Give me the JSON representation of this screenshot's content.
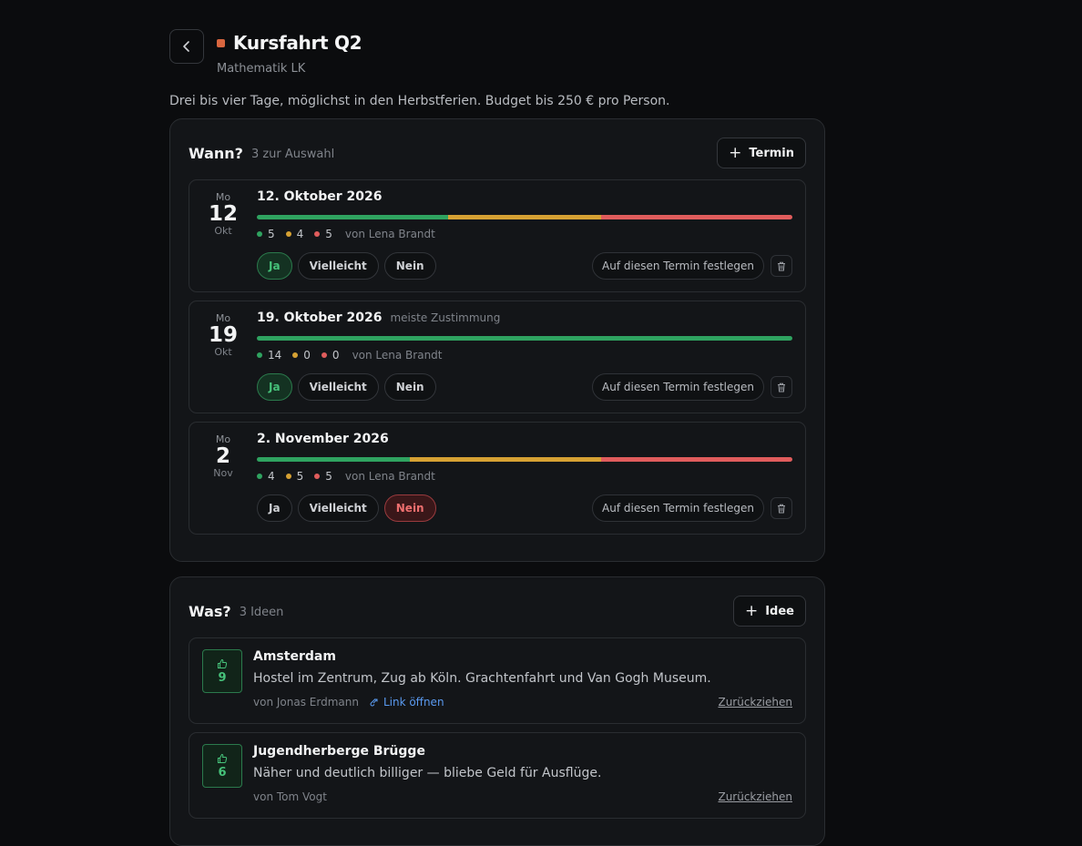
{
  "header": {
    "title": "Kursfahrt Q2",
    "subtitle": "Mathematik LK",
    "accent": "#d9663f",
    "description": "Drei bis vier Tage, möglichst in den Herbstferien. Budget bis 250 € pro Person."
  },
  "when": {
    "title": "Wann?",
    "count": "3 zur Auswahl",
    "add_label": "Termin",
    "options": [
      {
        "dow": "Mo",
        "day": "12",
        "month": "Okt",
        "label": "12. Oktober 2026",
        "note": "",
        "yes": 5,
        "maybe": 4,
        "no": 5,
        "yes_text": "5",
        "maybe_text": "4",
        "no_text": "5",
        "by": "von Lena Brandt",
        "my_vote": "ja",
        "ja": "Ja",
        "vielleicht": "Vielleicht",
        "nein": "Nein",
        "fix": "Auf diesen Termin festlegen"
      },
      {
        "dow": "Mo",
        "day": "19",
        "month": "Okt",
        "label": "19. Oktober 2026",
        "note": "meiste Zustimmung",
        "yes": 14,
        "maybe": 0,
        "no": 0,
        "yes_text": "14",
        "maybe_text": "0",
        "no_text": "0",
        "by": "von Lena Brandt",
        "my_vote": "ja",
        "ja": "Ja",
        "vielleicht": "Vielleicht",
        "nein": "Nein",
        "fix": "Auf diesen Termin festlegen"
      },
      {
        "dow": "Mo",
        "day": "2",
        "month": "Nov",
        "label": "2. November 2026",
        "note": "",
        "yes": 4,
        "maybe": 5,
        "no": 5,
        "yes_text": "4",
        "maybe_text": "5",
        "no_text": "5",
        "by": "von Lena Brandt",
        "my_vote": "nein",
        "ja": "Ja",
        "vielleicht": "Vielleicht",
        "nein": "Nein",
        "fix": "Auf diesen Termin festlegen"
      }
    ]
  },
  "what": {
    "title": "Was?",
    "count": "3 Ideen",
    "add_label": "Idee",
    "ideas": [
      {
        "votes": "9",
        "title": "Amsterdam",
        "desc": "Hostel im Zentrum, Zug ab Köln. Grachtenfahrt und Van Gogh Museum.",
        "by": "von Jonas Erdmann",
        "link": "Link öffnen",
        "withdraw": "Zurückziehen"
      },
      {
        "votes": "6",
        "title": "Jugendherberge Brügge",
        "desc": "Näher und deutlich billiger — bliebe Geld für Ausflüge.",
        "by": "von Tom Vogt",
        "link": "",
        "withdraw": "Zurückziehen"
      }
    ]
  },
  "colors": {
    "yes": "#2fa360",
    "maybe": "#d6a133",
    "no": "#e05c5c"
  }
}
